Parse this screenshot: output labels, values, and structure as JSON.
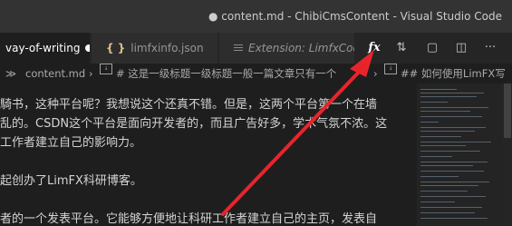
{
  "window": {
    "title": "● content.md - ChibiCmsContent - Visual Studio Code"
  },
  "tabs": [
    {
      "label": "vay-of-writing",
      "modified": true,
      "active": true
    },
    {
      "label": "limfxinfo.json",
      "icon": "json-braces-icon"
    },
    {
      "label": "Extension: LimfxCode",
      "icon": "extension-preview-icon"
    }
  ],
  "actions": [
    {
      "name": "fx-icon",
      "glyph": "fx"
    },
    {
      "name": "source-control-icon",
      "glyph": "⇅"
    },
    {
      "name": "open-preview-icon",
      "glyph": "▢"
    },
    {
      "name": "split-editor-icon",
      "glyph": "◫"
    },
    {
      "name": "more-actions-icon",
      "glyph": "···"
    }
  ],
  "breadcrumb": {
    "prefix": "≫",
    "file": "content.md",
    "sep1": "›",
    "heading1": "# 这是一级标题一级标题一般一篇文章只有一个",
    "sep2": "›",
    "heading2": "## 如何使用LimFX写"
  },
  "editor": {
    "lines": [
      "騎书，这种平台呢？我想说这个还真不错。但是，这两个平台第一个在墙",
      "乱的。CSDN这个平台是面向开发者的，而且广告好多，学术气氛不浓。这",
      "工作者建立自己的影响力。",
      "",
      "起创办了LimFX科研博客。",
      "",
      "者的一个发表平台。它能够方便地让科研工作者建立自己的主页，发表自"
    ]
  },
  "annotation": {
    "color": "#e8242b"
  }
}
